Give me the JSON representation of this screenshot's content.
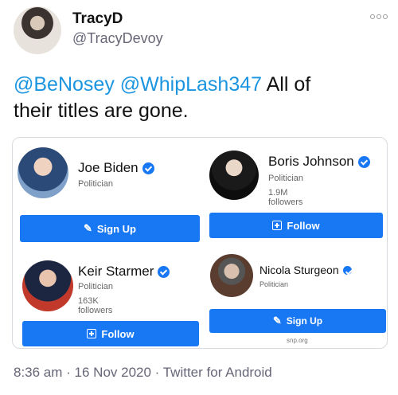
{
  "tweet": {
    "author_name": "TracyD",
    "author_handle": "@TracyDevoy",
    "mentions": [
      "@BeNosey",
      "@WhipLash347"
    ],
    "text_line1_rest": "All of",
    "text_line2": "their titles are gone.",
    "timestamp": "8:36 am · 16 Nov 2020 · Twitter for Android"
  },
  "cards": [
    {
      "name": "Joe Biden",
      "category": "Politician",
      "followers": "",
      "button": "Sign Up",
      "button_icon": "pencil-icon"
    },
    {
      "name": "Boris Johnson",
      "category": "Politician",
      "followers": "1.9M followers",
      "button": "Follow",
      "button_icon": "follow-icon"
    },
    {
      "name": "Keir Starmer",
      "category": "Politician",
      "followers": "163K followers",
      "button": "Follow",
      "button_icon": "follow-icon"
    },
    {
      "name": "Nicola Sturgeon",
      "category": "Politician",
      "followers": "",
      "button": "Sign Up",
      "button_icon": "pencil-icon",
      "website": "snp.org"
    }
  ],
  "colors": {
    "link": "#1b95e0",
    "facebook_blue": "#1877f2"
  }
}
